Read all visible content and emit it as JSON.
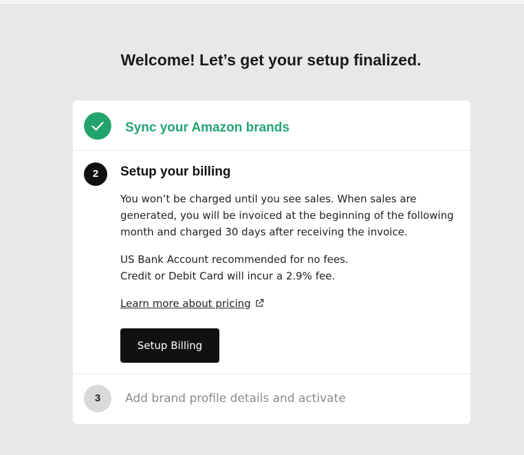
{
  "page": {
    "title": "Welcome! Let’s get your setup finalized."
  },
  "colors": {
    "accent_green": "#23a36e",
    "button_bg": "#111111",
    "muted_text": "#8a8a8a"
  },
  "steps": [
    {
      "number": "1",
      "status": "completed",
      "icon": "check-icon",
      "label": "Sync your Amazon brands"
    },
    {
      "number": "2",
      "status": "active",
      "title": "Setup your billing",
      "description": "You won’t be charged until you see sales. When sales are generated, you will be invoiced at the beginning of the following month and charged 30 days after receiving the invoice.",
      "fees": [
        "US Bank Account recommended for no fees.",
        "Credit or Debit Card will incur a 2.9% fee."
      ],
      "pricing_link": "Learn more about pricing",
      "pricing_link_icon": "external-link-icon",
      "button_label": "Setup Billing"
    },
    {
      "number": "3",
      "status": "pending",
      "label": "Add brand profile details and activate"
    }
  ]
}
